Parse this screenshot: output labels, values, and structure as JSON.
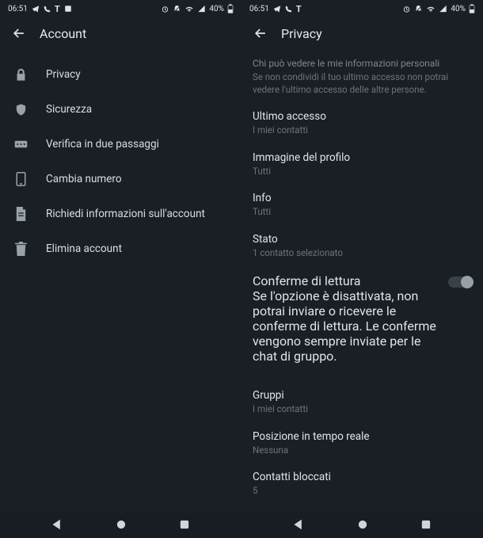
{
  "statusbar": {
    "time": "06:51",
    "batt": "40%"
  },
  "left": {
    "title": "Account",
    "items": [
      {
        "label": "Privacy",
        "icon": "lock"
      },
      {
        "label": "Sicurezza",
        "icon": "shield"
      },
      {
        "label": "Verifica in due passaggi",
        "icon": "password"
      },
      {
        "label": "Cambia numero",
        "icon": "phone"
      },
      {
        "label": "Richiedi informazioni sull'account",
        "icon": "document"
      },
      {
        "label": "Elimina account",
        "icon": "trash"
      }
    ]
  },
  "right": {
    "title": "Privacy",
    "intro_title": "Chi può vedere le mie informazioni personali",
    "intro_text": "Se non condividi il tuo ultimo accesso non potrai vedere l'ultimo accesso delle altre persone.",
    "settings": [
      {
        "title": "Ultimo accesso",
        "sub": "I miei contatti"
      },
      {
        "title": "Immagine del profilo",
        "sub": "Tutti"
      },
      {
        "title": "Info",
        "sub": "Tutti"
      },
      {
        "title": "Stato",
        "sub": "1 contatto selezionato"
      }
    ],
    "read": {
      "title": "Conferme di lettura",
      "desc": "Se l'opzione è disattivata, non potrai inviare o ricevere le conferme di lettura. Le conferme vengono sempre inviate per le chat di gruppo."
    },
    "bottom": [
      {
        "title": "Gruppi",
        "sub": "I miei contatti"
      },
      {
        "title": "Posizione in tempo reale",
        "sub": "Nessuna"
      },
      {
        "title": "Contatti bloccati",
        "sub": "5"
      }
    ]
  }
}
